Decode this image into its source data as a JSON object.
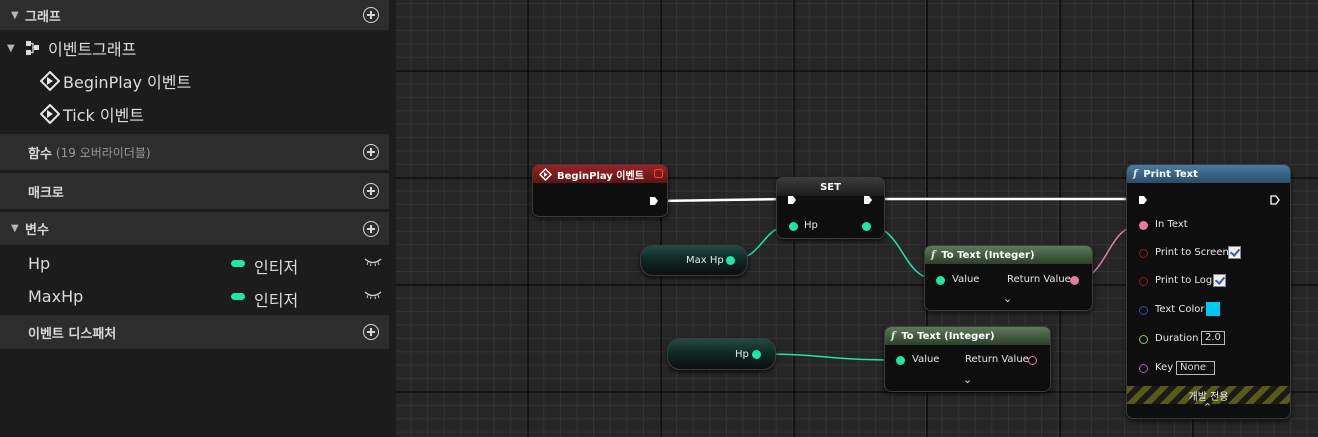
{
  "sidebar": {
    "graphs": {
      "title": "그래프"
    },
    "event_graph": {
      "label": "이벤트그래프",
      "items": [
        "BeginPlay 이벤트",
        "Tick 이벤트"
      ]
    },
    "functions": {
      "title": "함수",
      "note": "(19 오버라이더블)"
    },
    "macros": {
      "title": "매크로"
    },
    "variables": {
      "title": "변수",
      "items": [
        {
          "name": "Hp",
          "type": "인티저"
        },
        {
          "name": "MaxHp",
          "type": "인티저"
        }
      ]
    },
    "dispatchers": {
      "title": "이벤트 디스패처"
    }
  },
  "graph": {
    "begin_play": {
      "title": "BeginPlay 이벤트"
    },
    "set": {
      "title": "SET",
      "pin": "Hp"
    },
    "max_hp_getter": {
      "label": "Max Hp"
    },
    "hp_getter": {
      "label": "Hp"
    },
    "to_text_1": {
      "title": "To Text (Integer)",
      "in": "Value",
      "out": "Return Value"
    },
    "to_text_2": {
      "title": "To Text (Integer)",
      "in": "Value",
      "out": "Return Value"
    },
    "print_text": {
      "title": "Print Text",
      "pins": {
        "in_text": "In Text",
        "print_screen": "Print to Screen",
        "print_log": "Print to Log",
        "text_color": "Text Color",
        "duration": "Duration",
        "duration_value": "2.0",
        "key": "Key",
        "key_value": "None"
      },
      "dev_only": "개발 전용"
    }
  },
  "colors": {
    "event_header": "#8a1f1f",
    "function_header": "#4f6e4a",
    "print_header": "#3e6a8a",
    "exec_wire": "#ffffff",
    "int_pin": "#1ee6a8",
    "text_pin": "#e37aa4",
    "text_color_value": "#00c8f0"
  }
}
